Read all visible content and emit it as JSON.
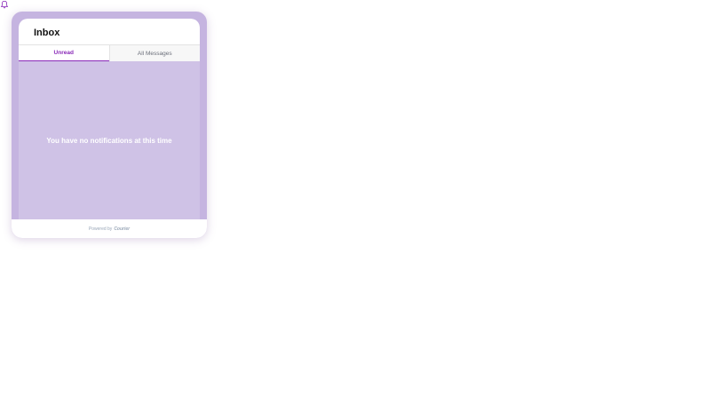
{
  "notifications_button": {
    "icon": "bell-icon",
    "color": "#8a2ab8"
  },
  "inbox": {
    "title": "Inbox",
    "tabs": [
      {
        "label": "Unread",
        "active": true
      },
      {
        "label": "All Messages",
        "active": false
      }
    ],
    "empty_message": "You have no notifications at this time"
  },
  "footer": {
    "powered_by": "Powered by",
    "brand": "Courier"
  },
  "colors": {
    "accent": "#8a2ab8",
    "panel_background": "#c5b4e0",
    "content_background": "#cfc2e6"
  }
}
